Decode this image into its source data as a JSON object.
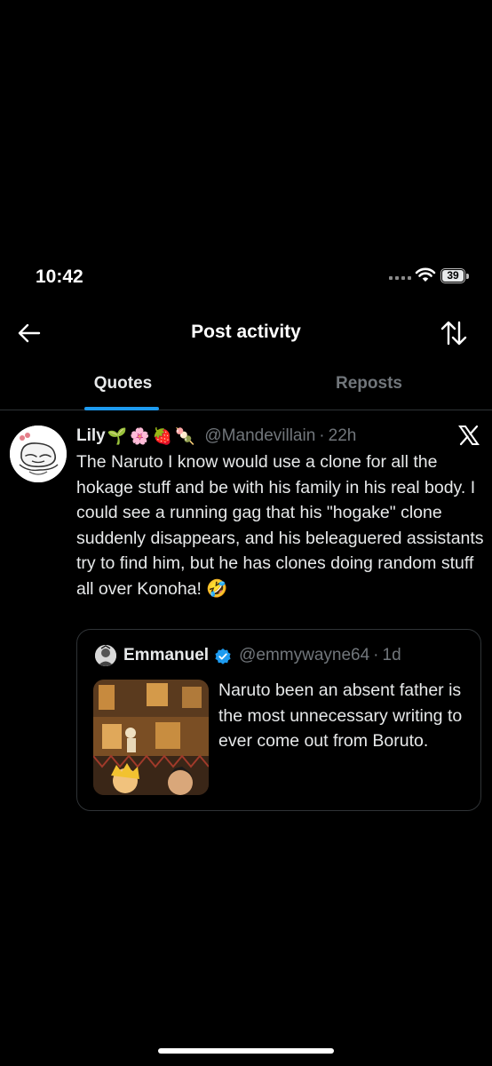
{
  "status_bar": {
    "time": "10:42",
    "signal_icon": "signal-icon",
    "wifi_icon": "wifi-icon",
    "battery_level": "39"
  },
  "header": {
    "back_icon": "back-arrow-icon",
    "title": "Post activity",
    "sort_icon": "sort-arrows-icon"
  },
  "tabs": [
    {
      "label": "Quotes",
      "active": true
    },
    {
      "label": "Reposts",
      "active": false
    }
  ],
  "post": {
    "author_name": "Lily",
    "author_emoji": "🌱🌸🍓🍡",
    "handle": "@Mandevillain",
    "separator": "·",
    "time": "22h",
    "platform_icon": "x-logo-icon",
    "text": "The Naruto I know would use a clone for all the hokage stuff and be with his family in his real body. I could see a running gag that his \"hogake\" clone suddenly disappears, and his beleaguered assistants try to find him, but he has clones doing random stuff all over Konoha! 🤣",
    "quoted": {
      "author_name": "Emmanuel",
      "verified": true,
      "handle": "@emmywayne64",
      "separator": "·",
      "time": "1d",
      "text": "Naruto been an absent father is the most unnecessary writing to ever come out from Boruto."
    }
  },
  "colors": {
    "background": "#000000",
    "text_primary": "#e7e9ea",
    "text_secondary": "#71767b",
    "accent": "#1d9bf0",
    "border": "#2f3336"
  }
}
